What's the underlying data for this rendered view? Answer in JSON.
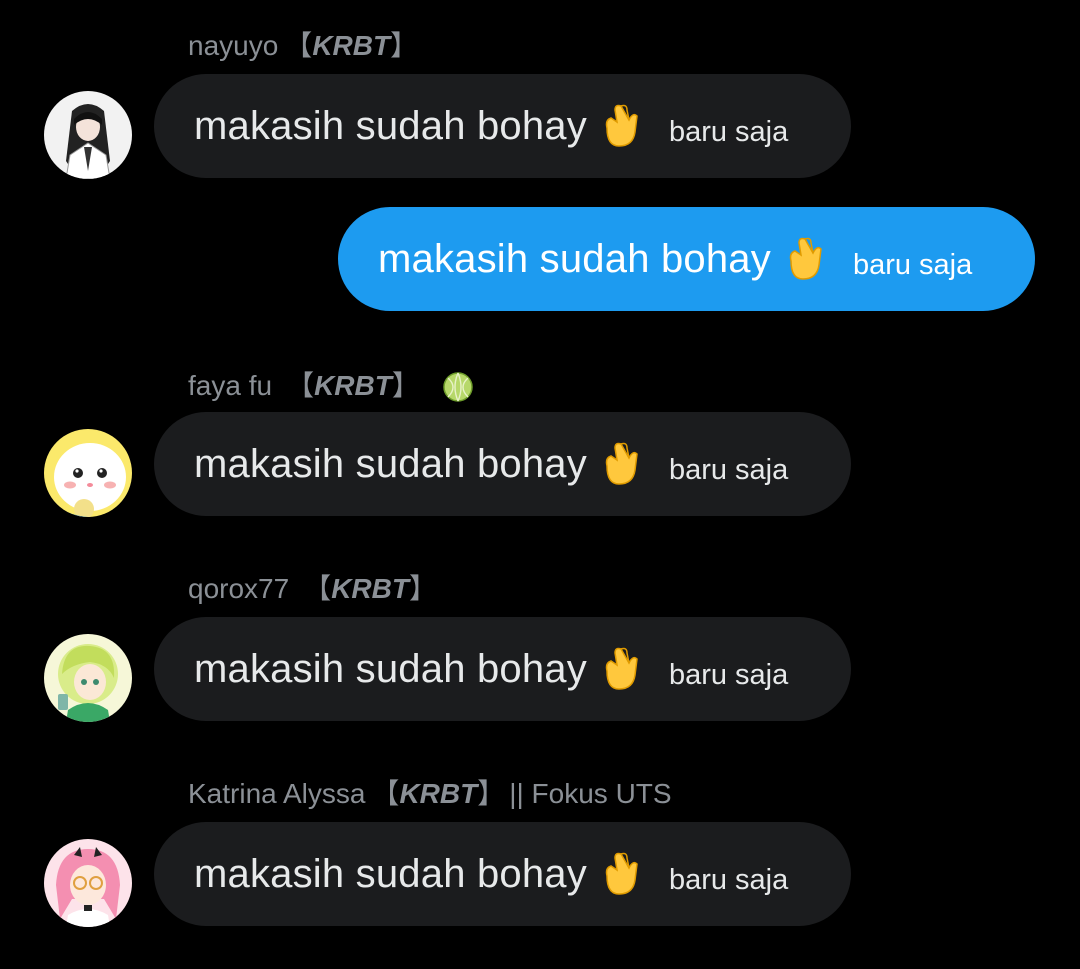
{
  "messages": [
    {
      "direction": "incoming",
      "sender_name": "nayuyo",
      "sender_tag_open": "【",
      "sender_tag": "KRBT",
      "sender_tag_close": "】",
      "sender_extra": "",
      "text": "makasih sudah bohay",
      "emoji": "pinched-fingers-heart-emoji",
      "time": "baru saja"
    },
    {
      "direction": "outgoing",
      "text": "makasih sudah bohay",
      "emoji": "pinched-fingers-heart-emoji",
      "time": "baru saja"
    },
    {
      "direction": "incoming",
      "sender_name": "faya fu",
      "sender_tag_open": "【",
      "sender_tag": "KRBT",
      "sender_tag_close": "】",
      "sender_extra_icon": "melon-emoji",
      "text": "makasih sudah bohay",
      "emoji": "pinched-fingers-heart-emoji",
      "time": "baru saja"
    },
    {
      "direction": "incoming",
      "sender_name": "qorox77",
      "sender_tag_open": "【",
      "sender_tag": "KRBT",
      "sender_tag_close": "】",
      "sender_extra": "",
      "text": "makasih sudah bohay",
      "emoji": "pinched-fingers-heart-emoji",
      "time": "baru saja"
    },
    {
      "direction": "incoming",
      "sender_name": "Katrina Alyssa",
      "sender_tag_open": "【",
      "sender_tag": "KRBT",
      "sender_tag_close": "】",
      "sender_extra": "|| Fokus UTS",
      "text": "makasih sudah bohay",
      "emoji": "pinched-fingers-heart-emoji",
      "time": "baru saja"
    }
  ],
  "colors": {
    "background": "#000000",
    "incoming_bubble": "#1b1c1e",
    "outgoing_bubble": "#1d9bf0",
    "sender_text": "#8b9096"
  }
}
